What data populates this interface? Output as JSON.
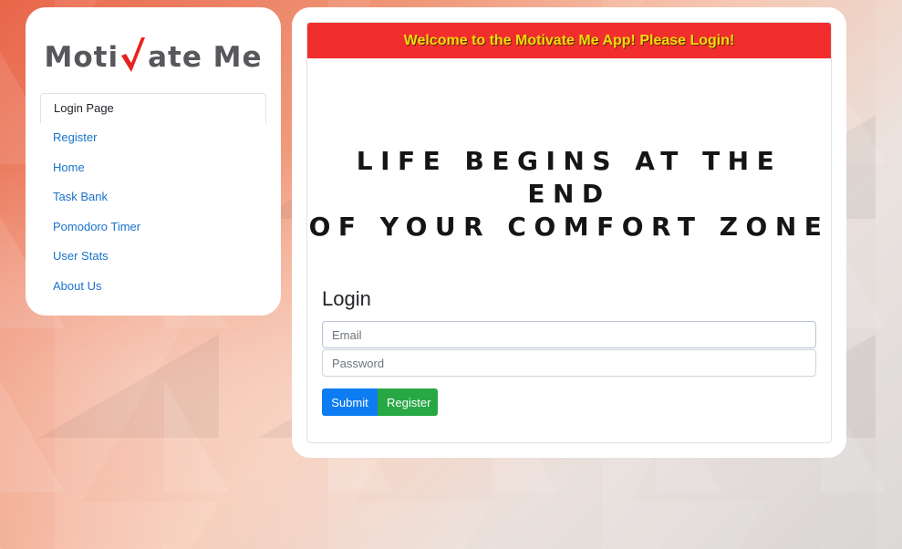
{
  "logo": {
    "text_left": "Moti",
    "text_right": "ate Me",
    "check_color": "#e8231f"
  },
  "sidebar": {
    "items": [
      {
        "label": "Login Page",
        "active": true
      },
      {
        "label": "Register"
      },
      {
        "label": "Home"
      },
      {
        "label": "Task Bank"
      },
      {
        "label": "Pomodoro Timer"
      },
      {
        "label": "User Stats"
      },
      {
        "label": "About Us"
      }
    ]
  },
  "banner": {
    "text": "Welcome to the Motivate Me App! Please Login!",
    "bg_color": "#f22d2d",
    "text_color": "#f5d90f"
  },
  "quote": {
    "line1": "LIFE BEGINS AT THE END",
    "line2": "OF YOUR COMFORT ZONE"
  },
  "login": {
    "title": "Login",
    "email_placeholder": "Email",
    "password_placeholder": "Password",
    "submit_label": "Submit",
    "register_label": "Register"
  },
  "colors": {
    "link": "#1a73c9",
    "submit": "#0d7bf2",
    "register": "#28a745"
  }
}
